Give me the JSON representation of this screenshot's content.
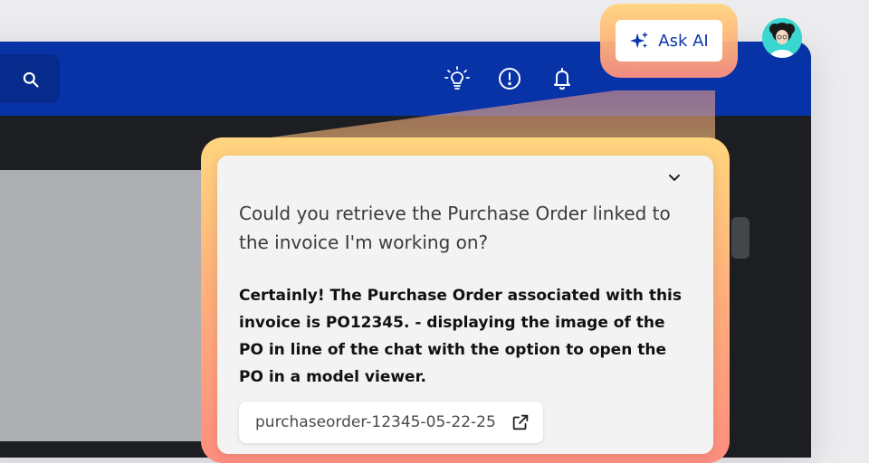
{
  "header": {
    "ask_ai_label": "Ask AI",
    "icons": [
      "search-icon",
      "lightbulb-icon",
      "alert-circle-icon",
      "bell-icon",
      "sparkle-icon",
      "avatar"
    ]
  },
  "chat": {
    "user_message": "Could you retrieve the Purchase Order linked to the invoice I'm working on?",
    "assistant_message": "Certainly! The Purchase Order associated with this invoice is PO12345.  - displaying the image of the PO in line of the chat with the option to open the PO in a model viewer.",
    "attachment": {
      "filename": "purchaseorder-12345-05-22-25"
    }
  },
  "colors": {
    "topbar": "#0733a7",
    "accent_text": "#0b36a9",
    "highlight_top": "#ffd57e",
    "highlight_bottom": "#ff8e7f"
  }
}
